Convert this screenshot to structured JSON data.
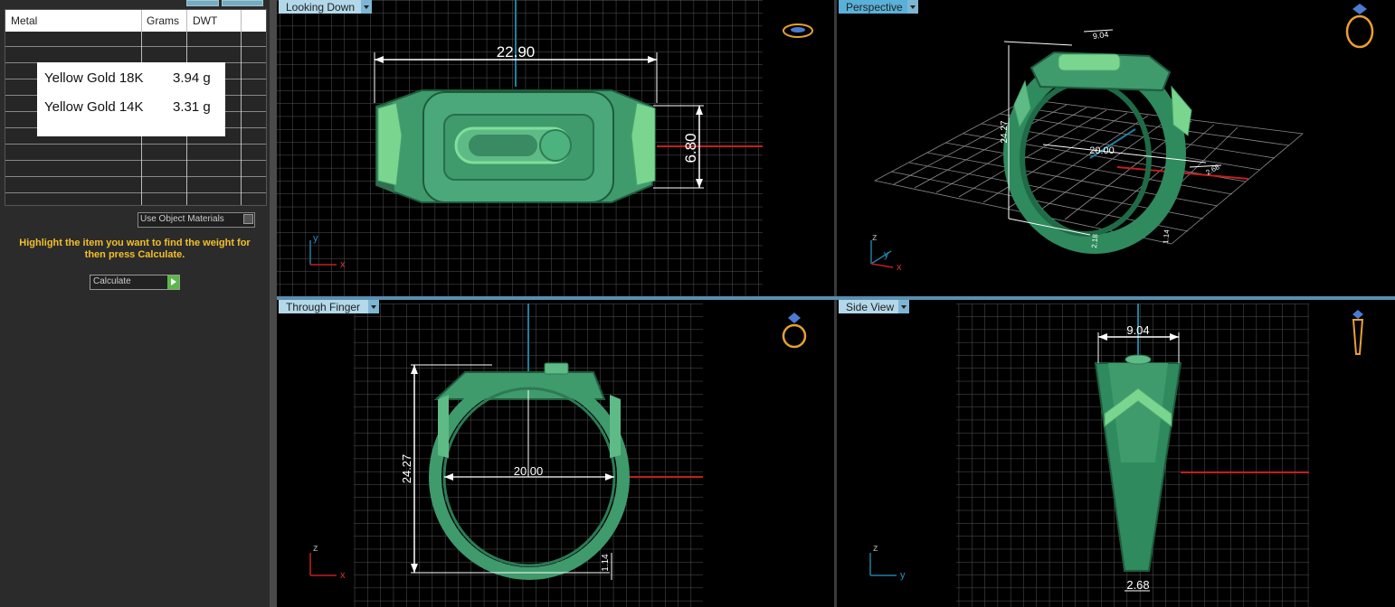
{
  "left_panel": {
    "table": {
      "headers": [
        "Metal",
        "Grams",
        "DWT"
      ],
      "rows": [
        {
          "metal": "Yellow Gold 18K",
          "grams": "3.94 g"
        },
        {
          "metal": "Yellow Gold 14K",
          "grams": "3.31 g"
        }
      ]
    },
    "use_object_materials": "Use Object Materials",
    "instructions": "Highlight the item you want to find the weight for then press Calculate.",
    "calculate": "Calculate"
  },
  "viewports": {
    "looking_down": {
      "tab": "Looking Down",
      "dims": {
        "width": "22.90",
        "height": "6.80"
      },
      "axes": {
        "v": "y",
        "h": "x"
      }
    },
    "perspective": {
      "tab": "Perspective",
      "dims": {
        "top": "9.04",
        "height": "24.27",
        "inner": "20.00",
        "side": "2.68",
        "bottom_a": "2.18",
        "bottom_b": "1.14"
      },
      "axes": {
        "v": "z",
        "h": "y",
        "d": "x"
      }
    },
    "through_finger": {
      "tab": "Through Finger",
      "dims": {
        "height": "24.27",
        "inner": "20.00",
        "bottom": "1.14"
      },
      "axes": {
        "v": "z",
        "h": "x"
      }
    },
    "side_view": {
      "tab": "Side View",
      "dims": {
        "top": "9.04",
        "bottom": "2.68"
      },
      "axes": {
        "v": "z",
        "h": "y"
      }
    }
  },
  "colors": {
    "ring_fill": "#3f9a6c",
    "ring_light": "#78d28a",
    "dimension": "#ffffff",
    "axis_red": "#c21f1f",
    "axis_blue": "#1f7fa0",
    "grid": "#6a6a6a",
    "instruction_text": "#f2c028",
    "viewport_tab": "#b3d8ea"
  }
}
